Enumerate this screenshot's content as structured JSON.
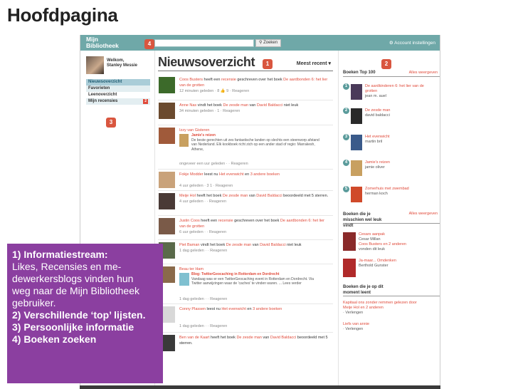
{
  "slide_title": "Hoofdpagina",
  "header": {
    "logo_line1": "Mijn",
    "logo_line2": "Bibliotheek",
    "search_button": "Zoeken",
    "account": "Account instellingen"
  },
  "sidebar": {
    "welcome_line1": "Welkom,",
    "welcome_line2": "Stanley Messie",
    "items": [
      {
        "label": "Nieuwsoverzicht"
      },
      {
        "label": "Favorieten"
      },
      {
        "label": "Leenoverzicht"
      },
      {
        "label": "Mijn recensies",
        "count": "2"
      }
    ]
  },
  "main": {
    "title": "Nieuwsoverzicht",
    "sort": "Meest recent",
    "feed": [
      {
        "name": "Coos Busters",
        "text1": " heeft een ",
        "link": "recensie",
        "text2": " geschreven over het boek ",
        "book": "De aardbonden 6: het lier van de grotten",
        "meta": "12 minuten geleden · 8 👍 9 · Reageren",
        "color": "#3c6a2a"
      },
      {
        "name": "Anne Nas",
        "text1": " vindt het boek ",
        "book": "De zesde man",
        "text2": " van ",
        "author": "David Baldacci",
        "text3": " niet leuk",
        "meta": "34 minuten geleden · 1 · Reageren",
        "color": "#6b4a2e"
      },
      {
        "name": "Izzy van Gisteren",
        "quote_title": "Jamie's reizen",
        "quote": "De beste gerechten uit zes fantastische landen op slechts een steenworp afstand van Nederland. Elk kookboek richt zich op een ander stad of regio: Marrakesh, Athene,",
        "meta": "ongeveer een uur geleden · · Reageren",
        "color": "#a05a3a"
      },
      {
        "name": "Fokje Modder",
        "text1": " leest nu ",
        "book": "Het evenwicht",
        "text2": " en ",
        "link": "3 andere boeken",
        "meta": "4 uur geleden · 3 1 · Reageren",
        "color": "#c9a27a"
      },
      {
        "name": "Meije Hol",
        "text1": " heeft het boek ",
        "book": "De zesde man",
        "text2": " van ",
        "author": "David Baldacci",
        "text3": " beoordeeld met 5 sterren.",
        "meta": "4 uur geleden · · Reageren",
        "color": "#4a3a36"
      },
      {
        "name": "Justin Coos",
        "text1": " heeft een ",
        "link": "recensie",
        "text2": " geschreven over het boek ",
        "book": "De aardbonden 6: het lier van de grotten",
        "meta": "6 uur geleden · · Reageren",
        "color": "#7a5a48"
      },
      {
        "name": "Piet Baman",
        "text1": " vindt het boek ",
        "book": "De zesde man",
        "text2": " van ",
        "author": "David Baldacci",
        "text3": " niet leuk",
        "meta": "1 dag geleden · · Reageren",
        "color": "#5a6a4a"
      },
      {
        "name": "Beau ter Ham",
        "quote_title": "Blog: TwitterGeocaching in Rotterdam en Dordrecht",
        "quote": "Vandaag was er een TwitterGeocaching event in Rotterdam en Dordrecht. Via Twitter aanwijzingen waar de 'caches' te vinden waren. ... Lees verder",
        "meta": "1 dag geleden · · Reageren",
        "color": "#8a6a4a"
      },
      {
        "name": "Conny Plassen",
        "text1": " leest nu ",
        "book": "Het evenwicht",
        "text2": " en ",
        "link": "3 andere boeken",
        "meta": "1 dag geleden · · Reageren",
        "color": "#d8d8d8"
      },
      {
        "name": "Ben van de Kaart",
        "text1": " heeft het boek ",
        "book": "De zesde man",
        "text2": " van ",
        "author": "David Baldacci",
        "text3": " beoordeeld met 5 sterren.",
        "meta": "1 dag geleden · · Reageren",
        "color": "#3a3a3a"
      }
    ]
  },
  "right": {
    "top_title": "Boeken Top 100",
    "top_link": "Alles weergeven",
    "top": [
      {
        "rank": "1",
        "title": "De aardkinderen 6: het lier van de grotten",
        "author": "jean m. auel",
        "color": "#4a3a5a"
      },
      {
        "rank": "2",
        "title": "De zesde man",
        "author": "david baldacci",
        "color": "#2a2a2a"
      },
      {
        "rank": "3",
        "title": "Het evenwicht",
        "author": "martin bril",
        "color": "#3a5a8a"
      },
      {
        "rank": "4",
        "title": "Jamie's reizen",
        "author": "jamie oliver",
        "color": "#c8a060"
      },
      {
        "rank": "5",
        "title": "Zomerhuis met zwembad",
        "author": "herman koch",
        "color": "#d04a2a"
      }
    ],
    "suggest_title": "Boeken die je misschien wel leuk vindt",
    "suggest_link": "Alles weergeven",
    "suggest": [
      {
        "title": "Cesars aanpak",
        "author": "Cesar Millan",
        "line3": "Coos Busters en 2 anderen",
        "line4": "vonden dit leuk",
        "color": "#8a2a2a"
      },
      {
        "title": "Ja-maar... Omdenken",
        "author": "Berthold Gunster",
        "color": "#b02a2a"
      }
    ],
    "due_title": "Boeken die je op dit moment leent",
    "due": [
      {
        "title": "Kapitaal ons zonder remmen gelezen door",
        "who": "Meije Hol en 2 anderen",
        "meta": "· Verlengen"
      },
      {
        "title": "Liefs van annie",
        "meta": "· Verlengen"
      }
    ]
  },
  "markers": [
    "1",
    "2",
    "3",
    "4"
  ],
  "note": {
    "line1": "1) Informatiestream:",
    "line2": "Likes, Recensies en me-",
    "line3": "dewerkersblogs vinden hun",
    "line4": "weg naar de Mijn Bibliotheek",
    "line5": "gebruiker.",
    "line6": "2) Verschillende ‘top’ lijsten.",
    "line7": "3) Persoonlijke informatie",
    "line8": "4) Boeken zoeken"
  }
}
